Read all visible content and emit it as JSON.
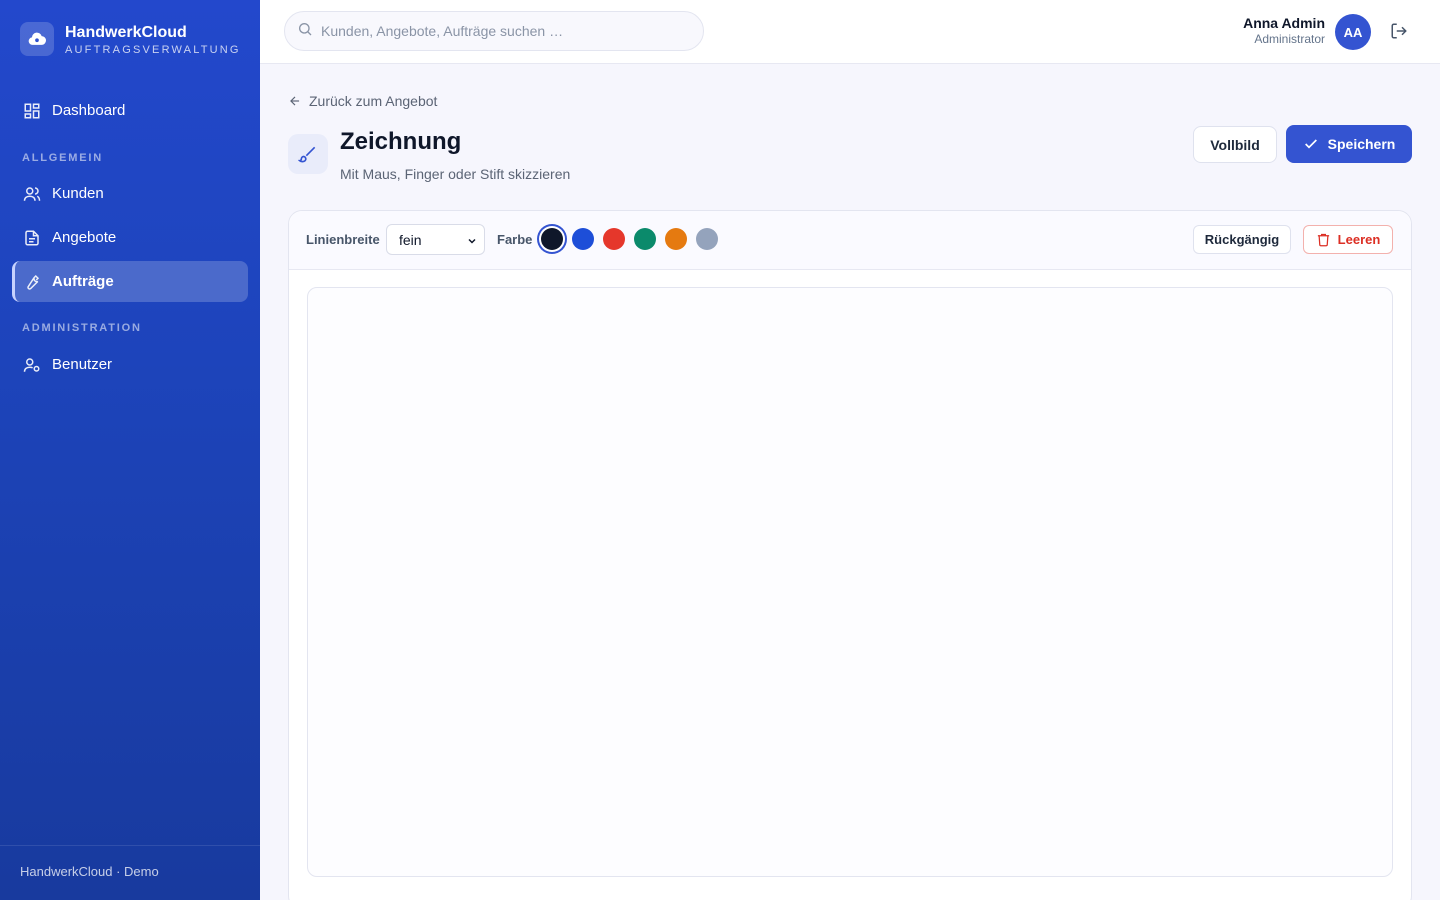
{
  "brand": {
    "name": "HandwerkCloud",
    "subtitle": "AUFTRAGSVERWALTUNG"
  },
  "sidebar": {
    "dashboard": "Dashboard",
    "section_general": "ALLGEMEIN",
    "customers": "Kunden",
    "offers": "Angebote",
    "orders": "Aufträge",
    "section_admin": "ADMINISTRATION",
    "users": "Benutzer",
    "active": "orders",
    "footer": "HandwerkCloud · Demo"
  },
  "header": {
    "search_placeholder": "Kunden, Angebote, Aufträge suchen …",
    "user_name": "Anna Admin",
    "user_role": "Administrator",
    "avatar_initials": "AA"
  },
  "page": {
    "back_label": "Zurück zum Angebot",
    "title": "Zeichnung",
    "subtitle": "Mit Maus, Finger oder Stift skizzieren",
    "fullscreen_label": "Vollbild",
    "save_label": "Speichern"
  },
  "toolbar": {
    "line_width_label": "Linienbreite",
    "line_width_value": "fein",
    "color_label": "Farbe",
    "colors": [
      "#0f172a",
      "#1d4ed8",
      "#e5372b",
      "#0b8a6b",
      "#e57a10",
      "#94a3bc"
    ],
    "selected_color": "#0f172a",
    "undo_label": "Rückgängig",
    "clear_label": "Leeren"
  },
  "theme": {
    "accent": "#3454d1",
    "danger": "#dc2f24"
  }
}
